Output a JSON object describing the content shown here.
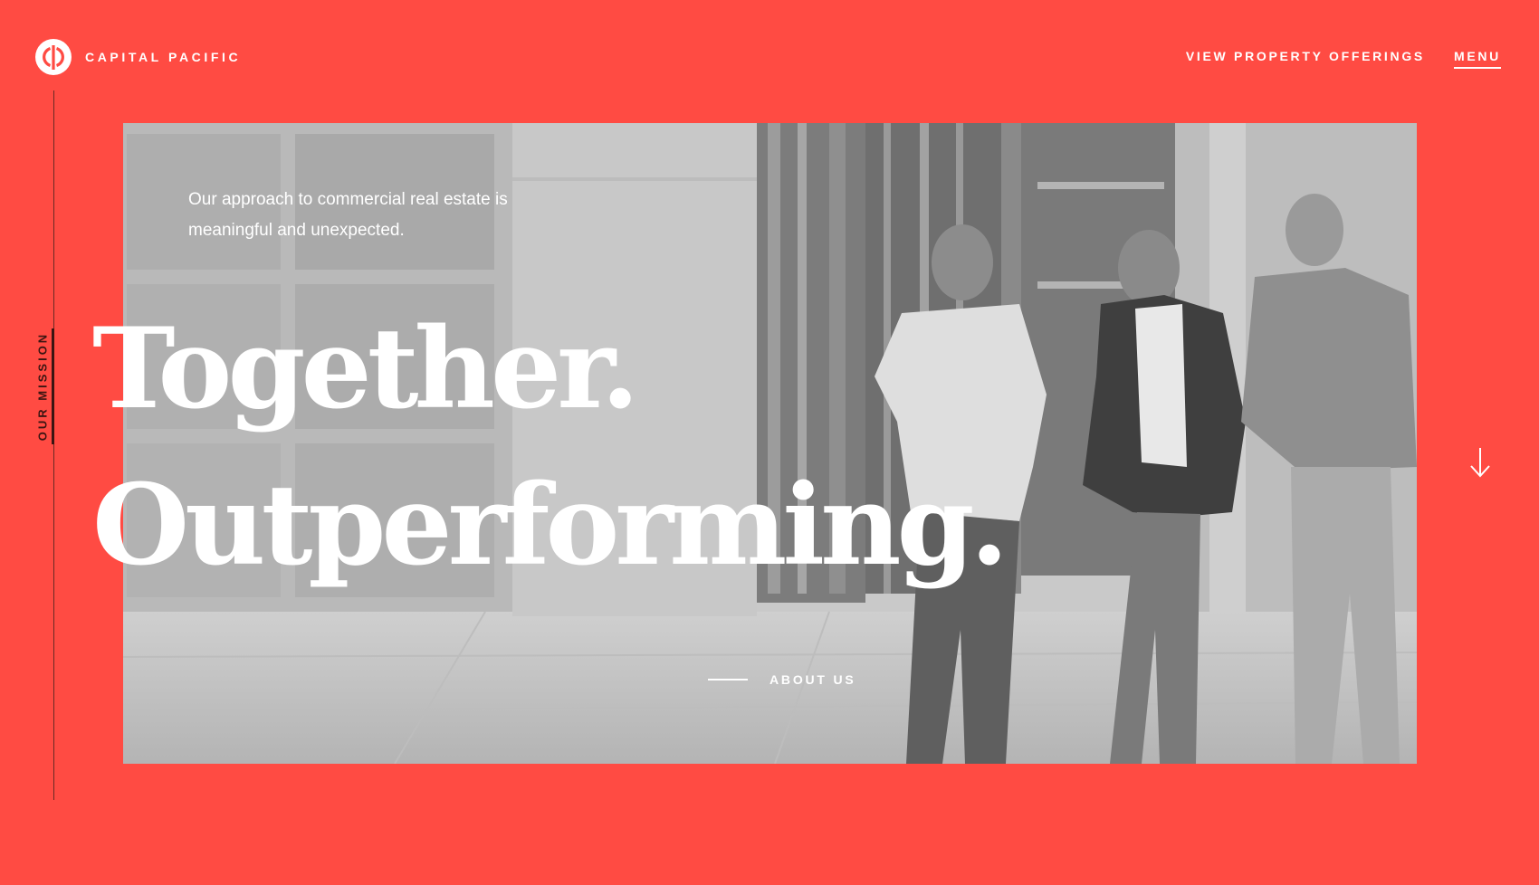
{
  "brand": {
    "name": "CAPITAL PACIFIC",
    "logo_icon": "capital-pacific-logo-icon"
  },
  "nav": {
    "offerings_label": "VIEW PROPERTY OFFERINGS",
    "menu_label": "MENU"
  },
  "side": {
    "section_label": "OUR MISSION"
  },
  "hero": {
    "intro": "Our approach to commercial real estate is meaningful and unexpected.",
    "headline_line1": "Together.",
    "headline_line2": "Outperforming.",
    "about_label": "ABOUT US",
    "scroll_icon": "arrow-down-icon"
  },
  "colors": {
    "background": "#FF4B43",
    "text": "#FFFFFF",
    "accent_dark": "#3A1512"
  }
}
